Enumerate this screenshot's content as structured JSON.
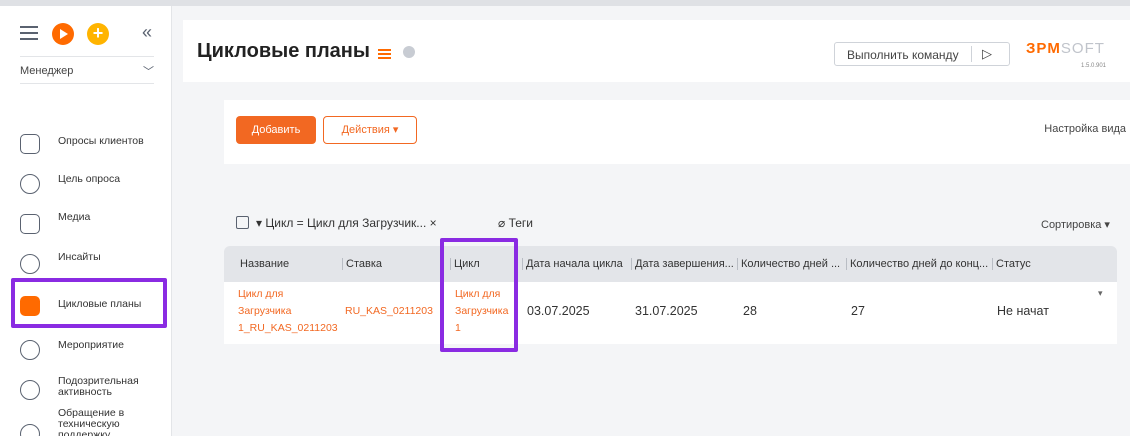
{
  "sidebar": {
    "role": "Менеджер",
    "items": [
      {
        "label": "Опросы клиентов",
        "icon": "survey-icon"
      },
      {
        "label": "Цель опроса",
        "icon": "target-icon"
      },
      {
        "label": "Медиа",
        "icon": "media-icon"
      },
      {
        "label": "Инсайты",
        "icon": "insights-icon"
      },
      {
        "label": "Цикловые планы",
        "icon": "calendar-icon",
        "active": true
      },
      {
        "label": "Мероприятие",
        "icon": "clock-icon"
      },
      {
        "label": "Подозрительная активность",
        "icon": "alert-icon"
      },
      {
        "label": "Обращение в техническую поддержку",
        "icon": "chat-icon"
      }
    ]
  },
  "header": {
    "title": "Цикловые планы",
    "command_label": "Выполнить команду",
    "logo_part1": "ЗPM",
    "logo_part2": "SOFT",
    "version": "1.5.0.901"
  },
  "toolbar": {
    "add_label": "Добавить",
    "actions_label": "Действия ▾",
    "view_settings": "Настройка вида"
  },
  "filter": {
    "text": "▾ Цикл = Цикл для Загрузчик... ×",
    "tags": "Теги",
    "sort": "Сортировка ▾"
  },
  "table": {
    "columns": [
      "Название",
      "Ставка",
      "Цикл",
      "Дата начала цикла",
      "Дата завершения...",
      "Количество дней ...",
      "Количество дней до конц...",
      "Статус"
    ],
    "row": {
      "name_1": "Цикл для",
      "name_2": "Загрузчика",
      "name_3": "1_RU_KAS_0211203",
      "rate": "RU_KAS_0211203",
      "cycle_1": "Цикл для",
      "cycle_2": "Загрузчика",
      "cycle_3": "1",
      "start": "03.07.2025",
      "end": "31.07.2025",
      "days": "28",
      "days_left": "27",
      "status": "Не начат"
    }
  },
  "colors": {
    "accent": "#f26822",
    "highlight": "#8a2be2"
  }
}
